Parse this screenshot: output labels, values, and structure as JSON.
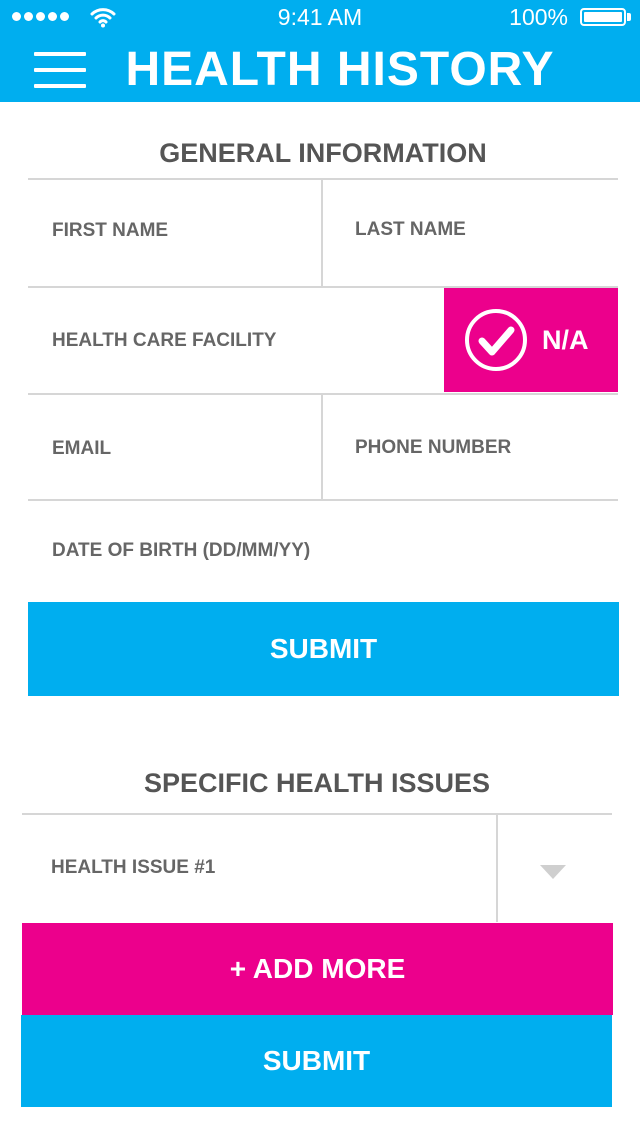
{
  "status_bar": {
    "time": "9:41 AM",
    "battery": "100%"
  },
  "header": {
    "title": "HEALTH HISTORY"
  },
  "general": {
    "title": "GENERAL INFORMATION",
    "first_name": "FIRST NAME",
    "last_name": "LAST NAME",
    "facility": "HEALTH CARE FACILITY",
    "na_label": "N/A",
    "email": "EMAIL",
    "phone": "PHONE NUMBER",
    "dob": "DATE OF BIRTH (DD/MM/YY)",
    "submit": "SUBMIT"
  },
  "issues": {
    "title": "SPECIFIC HEALTH ISSUES",
    "issue1": "HEALTH ISSUE #1",
    "add_more": "+ ADD MORE",
    "submit": "SUBMIT"
  },
  "colors": {
    "accent_blue": "#00aeef",
    "accent_pink": "#ec008c"
  },
  "icons": {
    "menu": "hamburger-icon",
    "check": "checkmark-circle-icon",
    "dropdown": "triangle-down-icon"
  }
}
